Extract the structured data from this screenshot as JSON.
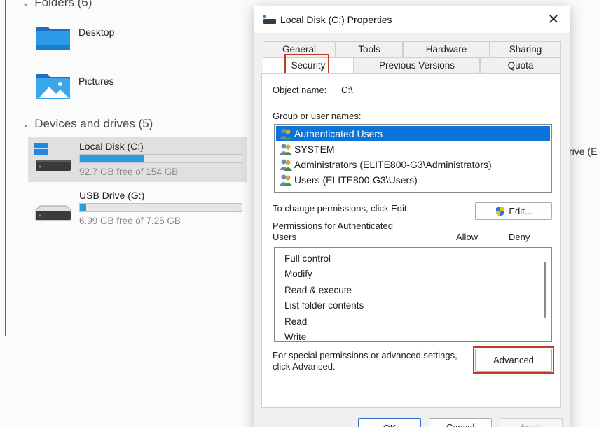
{
  "explorer": {
    "folders_header": "Folders (6)",
    "folders": [
      {
        "label": "Desktop",
        "icon": "desktop-folder-icon"
      },
      {
        "label": "Pictures",
        "icon": "pictures-folder-icon"
      }
    ],
    "devices_header": "Devices and drives (5)",
    "drives": [
      {
        "name": "Local Disk (C:)",
        "free": "92.7 GB free of 154 GB",
        "used_fraction": 0.4,
        "icon": "system-drive-icon",
        "selected": true
      },
      {
        "name": "USB Drive (G:)",
        "free": "6.99 GB free of 7.25 GB",
        "used_fraction": 0.04,
        "icon": "usb-drive-icon",
        "selected": false
      }
    ],
    "partial_label": "rive (E"
  },
  "dialog": {
    "title": "Local Disk (C:) Properties",
    "close_glyph": "✕",
    "tabs_row1": [
      "General",
      "Tools",
      "Hardware",
      "Sharing"
    ],
    "tabs_row2": [
      "Security",
      "Previous Versions",
      "Quota"
    ],
    "active_tab": "Security",
    "object_name_label": "Object name:",
    "object_name_value": "C:\\",
    "group_label": "Group or user names:",
    "users": [
      "Authenticated Users",
      "SYSTEM",
      "Administrators (ELITE800-G3\\Administrators)",
      "Users (ELITE800-G3\\Users)"
    ],
    "change_perm_text": "To change permissions, click Edit.",
    "edit_button": "Edit...",
    "permissions_for_line1": "Permissions for Authenticated",
    "permissions_for_line2": "Users",
    "allow_header": "Allow",
    "deny_header": "Deny",
    "permissions": [
      "Full control",
      "Modify",
      "Read & execute",
      "List folder contents",
      "Read",
      "Write"
    ],
    "special_line1": "For special permissions or advanced settings,",
    "special_line2": "click Advanced.",
    "advanced_button": "Advanced",
    "ok_button": "OK",
    "cancel_button": "Cancel",
    "apply_button": "Apply"
  },
  "colors": {
    "selection": "#0a74da",
    "highlight_box": "#c0392b",
    "drive_bar": "#2b9be2",
    "ok_border": "#2f6fc0"
  }
}
